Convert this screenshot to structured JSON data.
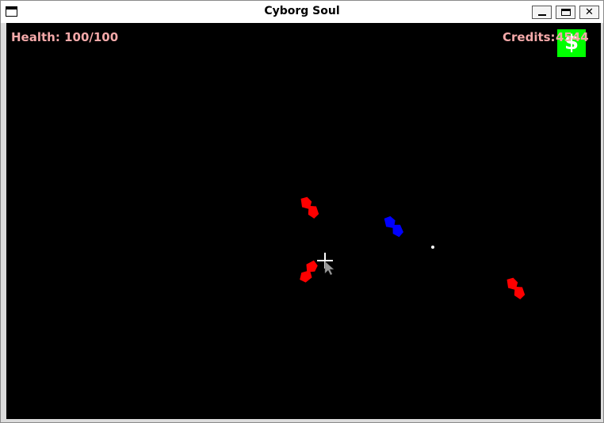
{
  "window": {
    "title": "Cyborg Soul",
    "buttons": {
      "minimize_icon": "minimize-icon",
      "maximize_icon": "maximize-icon",
      "close_label": "✕"
    }
  },
  "hud": {
    "health_label": "Health:",
    "health_value": "100/100",
    "credits_label": "Credits:",
    "credits_value": "4544",
    "shop_symbol": "$"
  },
  "colors": {
    "background": "#000000",
    "hud_text": "#f4a9a9",
    "shop_button": "#00ff00",
    "enemy": "#ff0000",
    "player": "#0000ff",
    "crosshair": "#ffffff"
  },
  "entities": {
    "enemies": [
      "enemy-ship",
      "enemy-ship",
      "enemy-ship"
    ],
    "player": "player-ship",
    "projectile": "bullet"
  }
}
